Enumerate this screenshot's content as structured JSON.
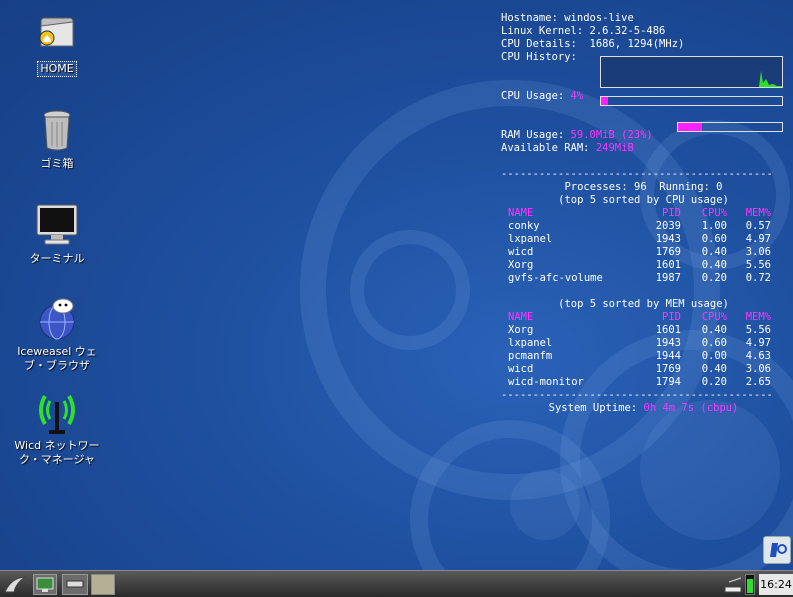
{
  "desktop": {
    "icons": [
      {
        "label": "HOME",
        "icon": "home-folder-icon"
      },
      {
        "label": "ゴミ箱",
        "icon": "trash-icon"
      },
      {
        "label": "ターミナル",
        "icon": "terminal-icon"
      },
      {
        "label": "Iceweasel ウェブ・ブラウザ",
        "icon": "web-browser-icon"
      },
      {
        "label": "Wicd ネットワーク・マネージャ",
        "icon": "network-manager-icon"
      }
    ]
  },
  "conky": {
    "hostname_label": "Hostname:",
    "hostname": "windos-live",
    "kernel_label": "Linux Kernel:",
    "kernel": "2.6.32-5-486",
    "cpu_details_label": "CPU Details:",
    "cpu_details": "1686, 1294(MHz)",
    "cpu_history_label": "CPU History:",
    "cpu_usage_label": "CPU Usage:",
    "cpu_usage": "4%",
    "cpu_usage_fraction": 0.04,
    "ram_usage_label": "RAM Usage:",
    "ram_usage": "59.0MiB (23%)",
    "ram_usage_fraction": 0.23,
    "available_ram_label": "Available RAM:",
    "available_ram": "249MiB",
    "separator": "-------------------------------------------",
    "processes_line": "Processes: 96  Running: 0",
    "top_cpu_title": "(top 5 sorted by CPU usage)",
    "top_mem_title": "(top 5 sorted by MEM usage)",
    "columns": [
      "NAME",
      "PID",
      "CPU%",
      "MEM%"
    ],
    "top_cpu": [
      [
        "conky",
        "2039",
        "1.00",
        "0.57"
      ],
      [
        "lxpanel",
        "1943",
        "0.60",
        "4.97"
      ],
      [
        "wicd",
        "1769",
        "0.40",
        "3.06"
      ],
      [
        "Xorg",
        "1601",
        "0.40",
        "5.56"
      ],
      [
        "gvfs-afc-volume",
        "1987",
        "0.20",
        "0.72"
      ]
    ],
    "top_mem": [
      [
        "Xorg",
        "1601",
        "0.40",
        "5.56"
      ],
      [
        "lxpanel",
        "1943",
        "0.60",
        "4.97"
      ],
      [
        "pcmanfm",
        "1944",
        "0.00",
        "4.63"
      ],
      [
        "wicd",
        "1769",
        "0.40",
        "3.06"
      ],
      [
        "wicd-monitor",
        "1794",
        "0.20",
        "2.65"
      ]
    ],
    "uptime_label": "System Uptime:",
    "uptime": "0h 4m 7s (cbpu)"
  },
  "taskbar": {
    "clock": "16:24",
    "menu_icon": "lxde-menu-icon",
    "desktop_icon": "show-desktop-icon",
    "window_icon": "window-icon"
  },
  "colors": {
    "accent": "#ff33ff",
    "desktop_bg": "#1e4f9e"
  }
}
